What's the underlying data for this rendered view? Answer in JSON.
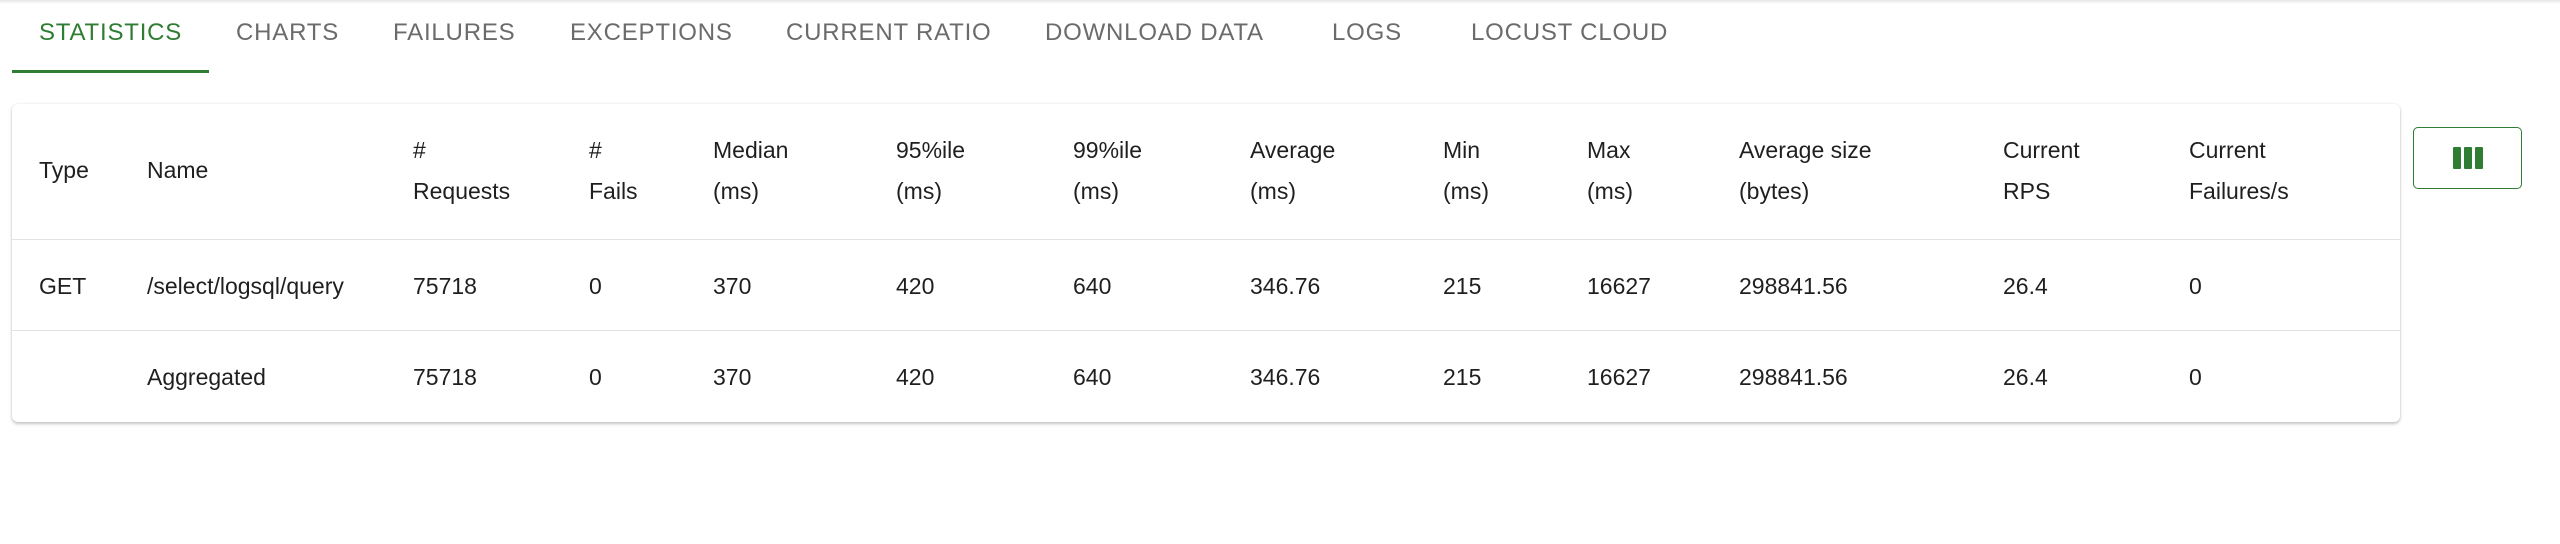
{
  "tabs": [
    {
      "label": "Statistics"
    },
    {
      "label": "Charts"
    },
    {
      "label": "Failures"
    },
    {
      "label": "Exceptions"
    },
    {
      "label": "Current ratio"
    },
    {
      "label": "Download Data"
    },
    {
      "label": "Logs"
    },
    {
      "label": "Locust Cloud"
    }
  ],
  "active_tab": "Statistics",
  "colors": {
    "accent": "#2e7d32",
    "tab_text": "#6b6b6b"
  },
  "table": {
    "headers": [
      {
        "line1": "Type",
        "line2": ""
      },
      {
        "line1": "Name",
        "line2": ""
      },
      {
        "line1": "#",
        "line2": "Requests"
      },
      {
        "line1": "#",
        "line2": "Fails"
      },
      {
        "line1": "Median",
        "line2": "(ms)"
      },
      {
        "line1": "95%ile",
        "line2": "(ms)"
      },
      {
        "line1": "99%ile",
        "line2": "(ms)"
      },
      {
        "line1": "Average",
        "line2": "(ms)"
      },
      {
        "line1": "Min",
        "line2": "(ms)"
      },
      {
        "line1": "Max",
        "line2": "(ms)"
      },
      {
        "line1": "Average size",
        "line2": "(bytes)"
      },
      {
        "line1": "Current",
        "line2": "RPS"
      },
      {
        "line1": "Current",
        "line2": "Failures/s"
      }
    ],
    "rows": [
      [
        "GET",
        "/select/logsql/query",
        "75718",
        "0",
        "370",
        "420",
        "640",
        "346.76",
        "215",
        "16627",
        "298841.56",
        "26.4",
        "0"
      ],
      [
        "",
        "Aggregated",
        "75718",
        "0",
        "370",
        "420",
        "640",
        "346.76",
        "215",
        "16627",
        "298841.56",
        "26.4",
        "0"
      ]
    ]
  },
  "column_toggle_icon": "view-column-icon"
}
